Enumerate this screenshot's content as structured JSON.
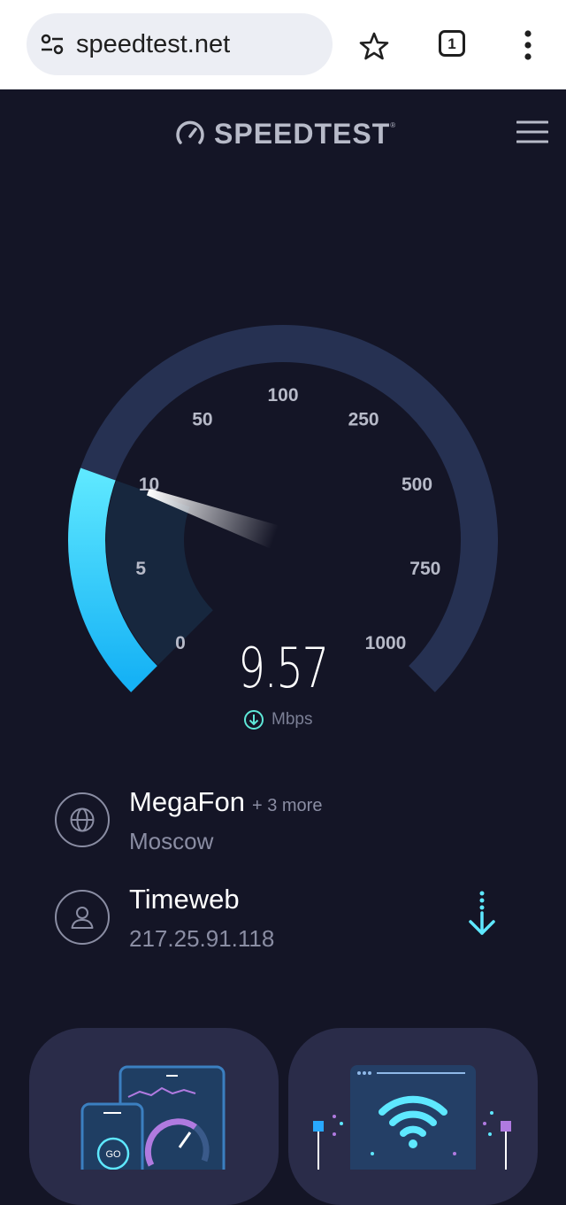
{
  "browser": {
    "url": "speedtest.net",
    "tab_count": "1"
  },
  "header": {
    "logo_text": "SPEEDTEST",
    "logo_tm": "®"
  },
  "gauge": {
    "ticks": [
      "0",
      "5",
      "10",
      "50",
      "100",
      "250",
      "500",
      "750",
      "1000"
    ],
    "current_value": 9.57,
    "max_value": 1000,
    "unit": "Mbps",
    "colors": {
      "track": "#263152",
      "fill_start": "#5ee8ff",
      "fill_end": "#16b2f5",
      "needle": "#ffffff"
    }
  },
  "speed": {
    "value_display": "9.57",
    "unit": "Mbps"
  },
  "provider": {
    "name": "MegaFon",
    "extra": "+ 3 more",
    "location": "Moscow",
    "icon": "globe-icon"
  },
  "server": {
    "name": "Timeweb",
    "ip": "217.25.91.118",
    "icon": "user-icon"
  },
  "colors": {
    "background": "#141526",
    "accent": "#5ee8ff",
    "card": "#2a2c49",
    "muted_text": "#8a8da3"
  }
}
